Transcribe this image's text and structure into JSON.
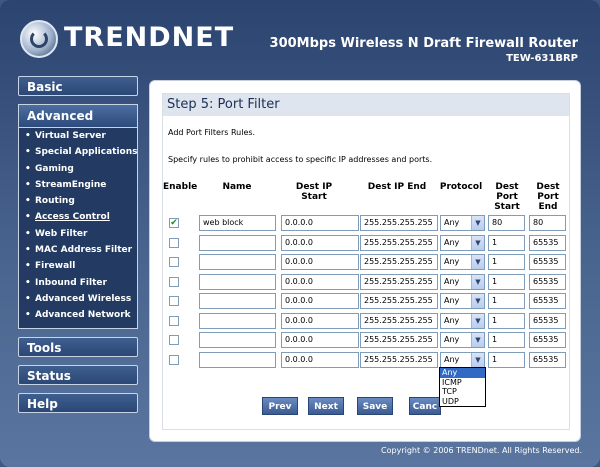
{
  "brand": {
    "logo_text": "TRENDNET"
  },
  "product": {
    "title": "300Mbps Wireless N Draft Firewall Router",
    "model": "TEW-631BRP"
  },
  "sidebar": {
    "basic": "Basic",
    "advanced": "Advanced",
    "advanced_items": [
      "Virtual Server",
      "Special Applications",
      "Gaming",
      "StreamEngine",
      "Routing",
      "Access Control",
      "Web Filter",
      "MAC Address Filter",
      "Firewall",
      "Inbound Filter",
      "Advanced Wireless",
      "Advanced Network"
    ],
    "current_item": "Access Control",
    "tools": "Tools",
    "status": "Status",
    "help": "Help"
  },
  "page": {
    "step_title": "Step 5: Port Filter",
    "desc1": "Add Port Filters Rules.",
    "desc2": "Specify rules to prohibit access to specific IP addresses and ports."
  },
  "table": {
    "headers": {
      "enable": "Enable",
      "name": "Name",
      "dest_ip_start": "Dest IP Start",
      "dest_ip_end": "Dest IP End",
      "protocol": "Protocol",
      "dest_port_start": "Dest Port Start",
      "dest_port_end": "Dest Port End"
    },
    "rows": [
      {
        "enabled": true,
        "name": "web block",
        "ip_start": "0.0.0.0",
        "ip_end": "255.255.255.255",
        "protocol": "Any",
        "port_start": "80",
        "port_end": "80"
      },
      {
        "enabled": false,
        "name": "",
        "ip_start": "0.0.0.0",
        "ip_end": "255.255.255.255",
        "protocol": "Any",
        "port_start": "1",
        "port_end": "65535"
      },
      {
        "enabled": false,
        "name": "",
        "ip_start": "0.0.0.0",
        "ip_end": "255.255.255.255",
        "protocol": "Any",
        "port_start": "1",
        "port_end": "65535"
      },
      {
        "enabled": false,
        "name": "",
        "ip_start": "0.0.0.0",
        "ip_end": "255.255.255.255",
        "protocol": "Any",
        "port_start": "1",
        "port_end": "65535"
      },
      {
        "enabled": false,
        "name": "",
        "ip_start": "0.0.0.0",
        "ip_end": "255.255.255.255",
        "protocol": "Any",
        "port_start": "1",
        "port_end": "65535"
      },
      {
        "enabled": false,
        "name": "",
        "ip_start": "0.0.0.0",
        "ip_end": "255.255.255.255",
        "protocol": "Any",
        "port_start": "1",
        "port_end": "65535"
      },
      {
        "enabled": false,
        "name": "",
        "ip_start": "0.0.0.0",
        "ip_end": "255.255.255.255",
        "protocol": "Any",
        "port_start": "1",
        "port_end": "65535"
      },
      {
        "enabled": false,
        "name": "",
        "ip_start": "0.0.0.0",
        "ip_end": "255.255.255.255",
        "protocol": "Any",
        "port_start": "1",
        "port_end": "65535"
      }
    ]
  },
  "protocol_dropdown": {
    "options": [
      "Any",
      "ICMP",
      "TCP",
      "UDP"
    ],
    "highlighted": "Any"
  },
  "buttons": {
    "prev": "Prev",
    "next": "Next",
    "save": "Save",
    "cancel": "Canc"
  },
  "footer": {
    "copyright": "Copyright © 2006 TRENDnet. All Rights Reserved."
  },
  "icons": {
    "logo": "trendnet-logo-icon",
    "checkbox_checked": "✔",
    "dropdown_arrow": "▼",
    "bullet": "•"
  },
  "colors": {
    "frame": "#3f587e",
    "panel": "#233a63",
    "button": "#3b5a93",
    "highlight": "#316ac5"
  }
}
